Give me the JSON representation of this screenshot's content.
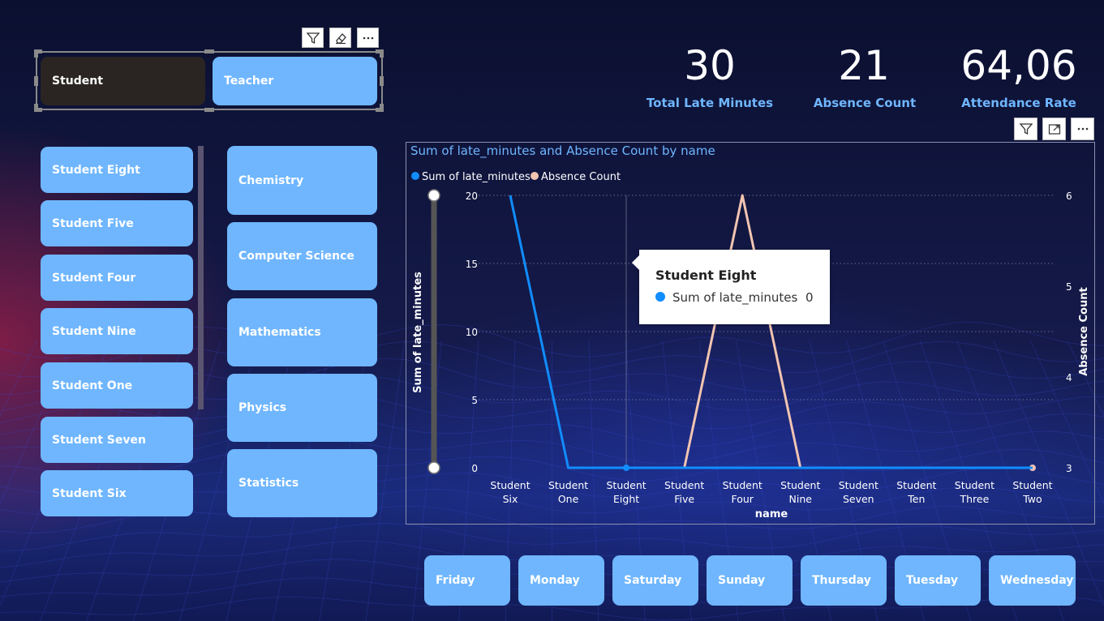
{
  "slicer_role": {
    "items": [
      {
        "label": "Student",
        "selected": true
      },
      {
        "label": "Teacher",
        "selected": false
      }
    ]
  },
  "slicer_names": {
    "items": [
      "Student Eight",
      "Student Five",
      "Student Four",
      "Student Nine",
      "Student One",
      "Student Seven",
      "Student Six"
    ]
  },
  "slicer_subjects": {
    "items": [
      "Chemistry",
      "Computer Science",
      "Mathematics",
      "Physics",
      "Statistics"
    ]
  },
  "slicer_days": {
    "items": [
      "Friday",
      "Monday",
      "Saturday",
      "Sunday",
      "Thursday",
      "Tuesday",
      "Wednesday"
    ]
  },
  "kpis": [
    {
      "value": "30",
      "label": "Total Late Minutes"
    },
    {
      "value": "21",
      "label": "Absence Count"
    },
    {
      "value": "64,06",
      "label": "Attendance Rate"
    }
  ],
  "toolbar_icons": [
    "filter-icon",
    "eraser-icon",
    "more-options-icon",
    "focus-mode-icon"
  ],
  "colors": {
    "tile": "#6fb6ff",
    "tile_selected": "#2a2523",
    "series_late": "#118dff",
    "series_absence": "#f2c4b1",
    "accent_text": "#6fb6ff"
  },
  "tooltip": {
    "title": "Student Eight",
    "series": "Sum of late_minutes",
    "value": "0"
  },
  "chart_data": {
    "type": "line",
    "title": "Sum of late_minutes and Absence Count by name",
    "xlabel": "name",
    "ylabel": "Sum of late_minutes",
    "y2label": "Absence Count",
    "categories": [
      [
        "Student",
        "Six"
      ],
      [
        "Student",
        "One"
      ],
      [
        "Student",
        "Eight"
      ],
      [
        "Student",
        "Five"
      ],
      [
        "Student",
        "Four"
      ],
      [
        "Student",
        "Nine"
      ],
      [
        "Student",
        "Seven"
      ],
      [
        "Student",
        "Ten"
      ],
      [
        "Student",
        "Three"
      ],
      [
        "Student",
        "Two"
      ]
    ],
    "ylim": [
      0,
      20
    ],
    "y2lim": [
      3,
      6
    ],
    "yticks": [
      "0",
      "5",
      "10",
      "15",
      "20"
    ],
    "y2ticks": [
      "3",
      "4",
      "5",
      "6"
    ],
    "legend_position": "top-left",
    "grid": true,
    "series": [
      {
        "name": "Sum of late_minutes",
        "axis": "left",
        "values": [
          20,
          0,
          0,
          0,
          0,
          0,
          0,
          0,
          0,
          0
        ]
      },
      {
        "name": "Absence Count",
        "axis": "right",
        "values": [
          null,
          null,
          null,
          3,
          6,
          3,
          3,
          3,
          null,
          3
        ]
      }
    ]
  }
}
